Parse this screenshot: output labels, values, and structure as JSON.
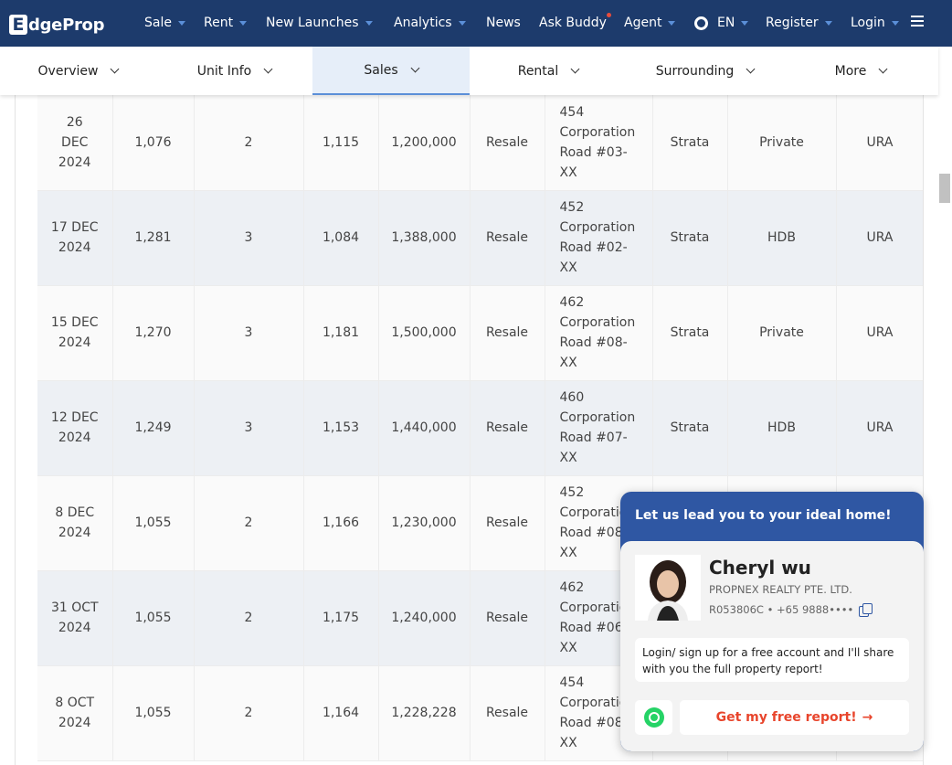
{
  "brand": {
    "logo_letter": "E",
    "logo_text": "dgeProp",
    "primary_color": "#1d3b6c",
    "accent_color": "#5b8fd8"
  },
  "nav": {
    "items": [
      {
        "label": "Sale",
        "dropdown": true
      },
      {
        "label": "Rent",
        "dropdown": true
      },
      {
        "label": "New Launches",
        "dropdown": true
      },
      {
        "label": "Analytics",
        "dropdown": true
      },
      {
        "label": "News",
        "dropdown": false
      },
      {
        "label": "Ask Buddy",
        "dropdown": false
      },
      {
        "label": "Agent",
        "dropdown": true
      },
      {
        "label": "EN",
        "dropdown": true
      },
      {
        "label": "Register",
        "dropdown": true
      },
      {
        "label": "Login",
        "dropdown": true
      }
    ]
  },
  "tabs": [
    {
      "label": "Overview",
      "active": false
    },
    {
      "label": "Unit Info",
      "active": false
    },
    {
      "label": "Sales",
      "active": true
    },
    {
      "label": "Rental",
      "active": false
    },
    {
      "label": "Surrounding",
      "active": false
    },
    {
      "label": "More",
      "active": false
    }
  ],
  "table": {
    "rows": [
      {
        "date": "26\nDEC\n2024",
        "size": "1,076",
        "beds": "2",
        "psf": "1,115",
        "price": "1,200,000",
        "type": "Resale",
        "address": "454\nCorporation\nRoad #03-\nXX",
        "tenure": "Strata",
        "category": "Private",
        "source": "URA"
      },
      {
        "date": "17 DEC\n2024",
        "size": "1,281",
        "beds": "3",
        "psf": "1,084",
        "price": "1,388,000",
        "type": "Resale",
        "address": "452\nCorporation\nRoad #02-\nXX",
        "tenure": "Strata",
        "category": "HDB",
        "source": "URA"
      },
      {
        "date": "15 DEC\n2024",
        "size": "1,270",
        "beds": "3",
        "psf": "1,181",
        "price": "1,500,000",
        "type": "Resale",
        "address": "462\nCorporation\nRoad #08-\nXX",
        "tenure": "Strata",
        "category": "Private",
        "source": "URA"
      },
      {
        "date": "12 DEC\n2024",
        "size": "1,249",
        "beds": "3",
        "psf": "1,153",
        "price": "1,440,000",
        "type": "Resale",
        "address": "460\nCorporation\nRoad #07-\nXX",
        "tenure": "Strata",
        "category": "HDB",
        "source": "URA"
      },
      {
        "date": "8 DEC\n2024",
        "size": "1,055",
        "beds": "2",
        "psf": "1,166",
        "price": "1,230,000",
        "type": "Resale",
        "address": "452\nCorporatio\nRoad #08\nXX",
        "tenure": "",
        "category": "",
        "source": ""
      },
      {
        "date": "31 OCT\n2024",
        "size": "1,055",
        "beds": "2",
        "psf": "1,175",
        "price": "1,240,000",
        "type": "Resale",
        "address": "462\nCorporatio\nRoad #06\nXX",
        "tenure": "",
        "category": "",
        "source": ""
      },
      {
        "date": "8 OCT\n2024",
        "size": "1,055",
        "beds": "2",
        "psf": "1,164",
        "price": "1,228,228",
        "type": "Resale",
        "address": "454\nCorporatio\nRoad #08\nXX",
        "tenure": "",
        "category": "",
        "source": ""
      }
    ]
  },
  "popup": {
    "heading": "Let us lead you to your ideal home!",
    "agent_name": "Cheryl wu",
    "agency": "PROPNEX REALTY PTE. LTD.",
    "contact": "R053806C • +65 9888••••",
    "message": "Login/ sign up for a free account and I'll share with you the full property report!",
    "cta": "Get my free report!",
    "cta_color": "#e8452c"
  }
}
